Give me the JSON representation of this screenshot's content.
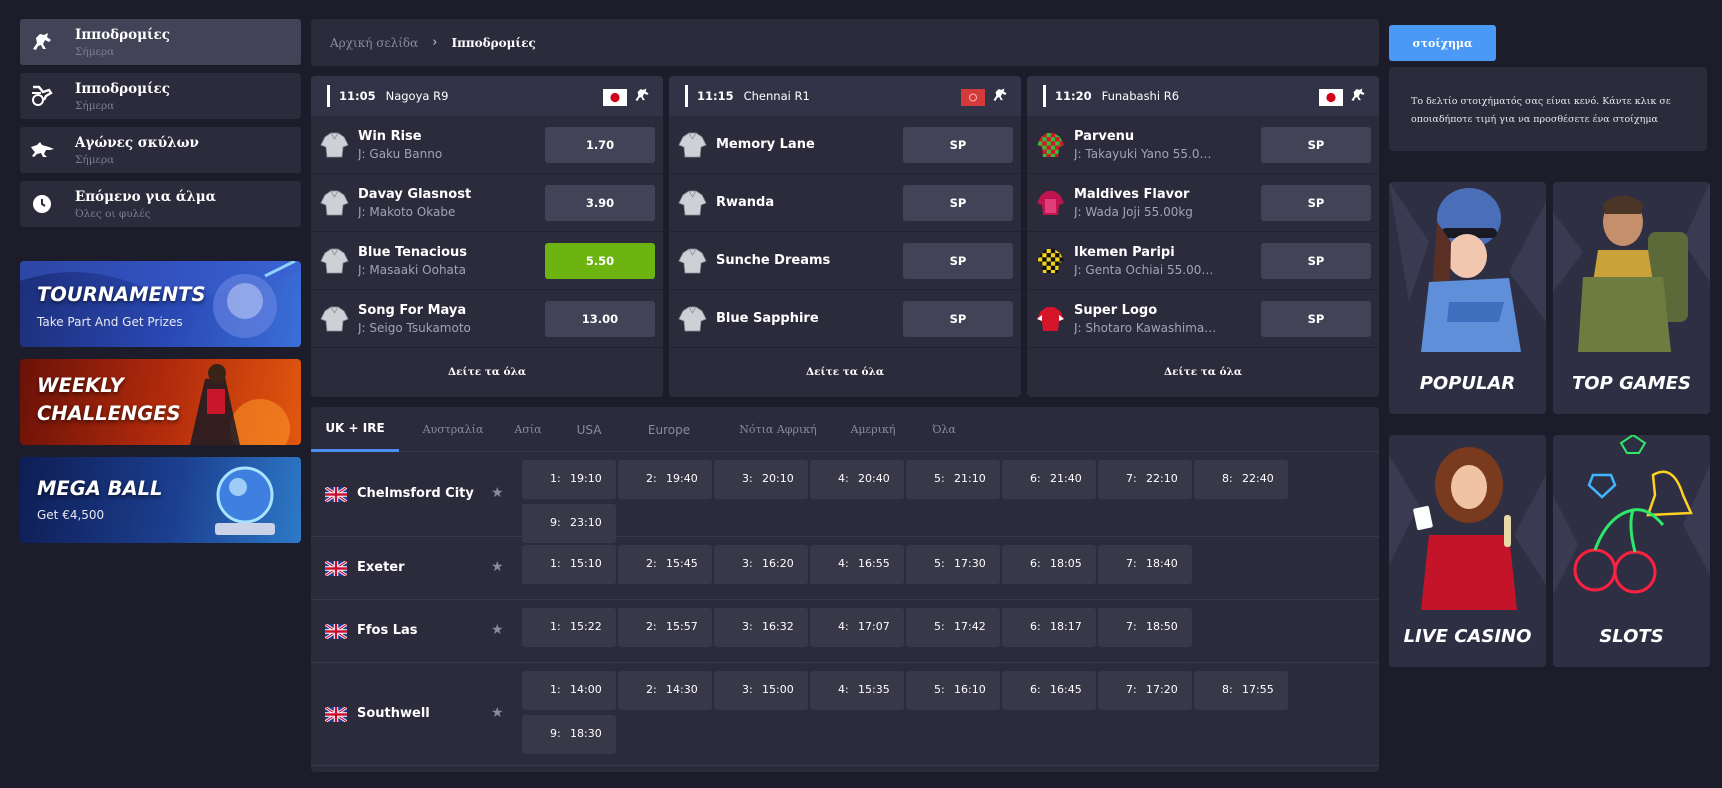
{
  "sidebar": {
    "items": [
      {
        "label": "Ιπποδρομίες",
        "sub": "Σήμερα",
        "icon": "horse-racing-icon"
      },
      {
        "label": "Ιπποδρομίες",
        "sub": "Σήμερα",
        "icon": "harness-racing-icon"
      },
      {
        "label": "Αγώνες σκύλων",
        "sub": "Σήμερα",
        "icon": "greyhound-icon"
      },
      {
        "label": "Επόμενο για άλμα",
        "sub": "Όλες οι φυλές",
        "icon": "clock-icon"
      }
    ],
    "promos": [
      {
        "title": "TOURNAMENTS",
        "sub": "Take Part And Get Prizes"
      },
      {
        "title": "WEEKLY\nCHALLENGES",
        "sub": ""
      },
      {
        "title": "MEGA BALL",
        "sub": "Get €4,500"
      }
    ]
  },
  "breadcrumb": {
    "home": "Αρχική σελίδα",
    "separator": "›",
    "current": "Ιπποδρομίες"
  },
  "race_cards": [
    {
      "time": "11:05",
      "name": "Nagoya R9",
      "flag": "japan-flag",
      "runners": [
        {
          "name": "Win Rise",
          "jockey": "J: Gaku Banno",
          "odds": "1.70",
          "selected": false,
          "silk": "grey-silk"
        },
        {
          "name": "Davay Glasnost",
          "jockey": "J: Makoto Okabe",
          "odds": "3.90",
          "selected": false,
          "silk": "grey-silk"
        },
        {
          "name": "Blue Tenacious",
          "jockey": "J: Masaaki Oohata",
          "odds": "5.50",
          "selected": true,
          "silk": "grey-silk"
        },
        {
          "name": "Song For Maya",
          "jockey": "J: Seigo Tsukamoto",
          "odds": "13.00",
          "selected": false,
          "silk": "grey-silk"
        }
      ],
      "see_all": "Δείτε τα όλα"
    },
    {
      "time": "11:15",
      "name": "Chennai R1",
      "flag": "india-flag",
      "runners": [
        {
          "name": "Memory Lane",
          "jockey": "",
          "odds": "SP",
          "selected": false,
          "silk": "grey-silk"
        },
        {
          "name": "Rwanda",
          "jockey": "",
          "odds": "SP",
          "selected": false,
          "silk": "grey-silk"
        },
        {
          "name": "Sunche Dreams",
          "jockey": "",
          "odds": "SP",
          "selected": false,
          "silk": "grey-silk"
        },
        {
          "name": "Blue Sapphire",
          "jockey": "",
          "odds": "SP",
          "selected": false,
          "silk": "grey-silk"
        }
      ],
      "see_all": "Δείτε τα όλα"
    },
    {
      "time": "11:20",
      "name": "Funabashi R6",
      "flag": "japan-flag",
      "runners": [
        {
          "name": "Parvenu",
          "jockey": "J: Takayuki Yano 55.0…",
          "odds": "SP",
          "selected": false,
          "silk": "red-green-check-silk"
        },
        {
          "name": "Maldives Flavor",
          "jockey": "J: Wada Joji 55.00kg",
          "odds": "SP",
          "selected": false,
          "silk": "magenta-silk"
        },
        {
          "name": "Ikemen Paripi",
          "jockey": "J: Genta Ochiai 55.00…",
          "odds": "SP",
          "selected": false,
          "silk": "yellow-black-check-silk"
        },
        {
          "name": "Super Logo",
          "jockey": "J: Shotaro Kawashima…",
          "odds": "SP",
          "selected": false,
          "silk": "red-silk"
        }
      ],
      "see_all": "Δείτε τα όλα"
    }
  ],
  "tabs": [
    "UK + IRE",
    "Αυστραλία",
    "Ασία",
    "USA",
    "Europe",
    "Νότια Αφρική",
    "Αμερική",
    "Όλα"
  ],
  "active_tab": "UK + IRE",
  "tracks": [
    {
      "name": "Chelmsford City",
      "flag": "uk-flag",
      "races": [
        {
          "no": "1:",
          "time": "19:10"
        },
        {
          "no": "2:",
          "time": "19:40"
        },
        {
          "no": "3:",
          "time": "20:10"
        },
        {
          "no": "4:",
          "time": "20:40"
        },
        {
          "no": "5:",
          "time": "21:10"
        },
        {
          "no": "6:",
          "time": "21:40"
        },
        {
          "no": "7:",
          "time": "22:10"
        },
        {
          "no": "8:",
          "time": "22:40"
        },
        {
          "no": "9:",
          "time": "23:10"
        }
      ]
    },
    {
      "name": "Exeter",
      "flag": "uk-flag",
      "races": [
        {
          "no": "1:",
          "time": "15:10"
        },
        {
          "no": "2:",
          "time": "15:45"
        },
        {
          "no": "3:",
          "time": "16:20"
        },
        {
          "no": "4:",
          "time": "16:55"
        },
        {
          "no": "5:",
          "time": "17:30"
        },
        {
          "no": "6:",
          "time": "18:05"
        },
        {
          "no": "7:",
          "time": "18:40"
        }
      ]
    },
    {
      "name": "Ffos Las",
      "flag": "uk-flag",
      "races": [
        {
          "no": "1:",
          "time": "15:22"
        },
        {
          "no": "2:",
          "time": "15:57"
        },
        {
          "no": "3:",
          "time": "16:32"
        },
        {
          "no": "4:",
          "time": "17:07"
        },
        {
          "no": "5:",
          "time": "17:42"
        },
        {
          "no": "6:",
          "time": "18:17"
        },
        {
          "no": "7:",
          "time": "18:50"
        }
      ]
    },
    {
      "name": "Southwell",
      "flag": "uk-flag",
      "races": [
        {
          "no": "1:",
          "time": "14:00"
        },
        {
          "no": "2:",
          "time": "14:30"
        },
        {
          "no": "3:",
          "time": "15:00"
        },
        {
          "no": "4:",
          "time": "15:35"
        },
        {
          "no": "5:",
          "time": "16:10"
        },
        {
          "no": "6:",
          "time": "16:45"
        },
        {
          "no": "7:",
          "time": "17:20"
        },
        {
          "no": "8:",
          "time": "17:55"
        },
        {
          "no": "9:",
          "time": "18:30"
        }
      ]
    }
  ],
  "betslip": {
    "tab_label": "στοίχημα",
    "empty_message": "Το δελτίο στοιχήματός σας είναι κενό. Κάντε κλικ σε οποιαδήποτε τιμή για να προσθέσετε ένα στοίχημα"
  },
  "game_tiles": [
    {
      "label": "POPULAR",
      "icon": "police-girl-illustration"
    },
    {
      "label": "TOP GAMES",
      "icon": "adventurer-illustration"
    },
    {
      "label": "LIVE CASINO",
      "icon": "dealer-illustration"
    },
    {
      "label": "SLOTS",
      "icon": "slot-symbols-illustration"
    }
  ],
  "colors": {
    "accent_blue": "#4a9af5",
    "selected_green": "#6eb411",
    "panel": "#2b2b3c",
    "background": "#1c1c2b"
  }
}
